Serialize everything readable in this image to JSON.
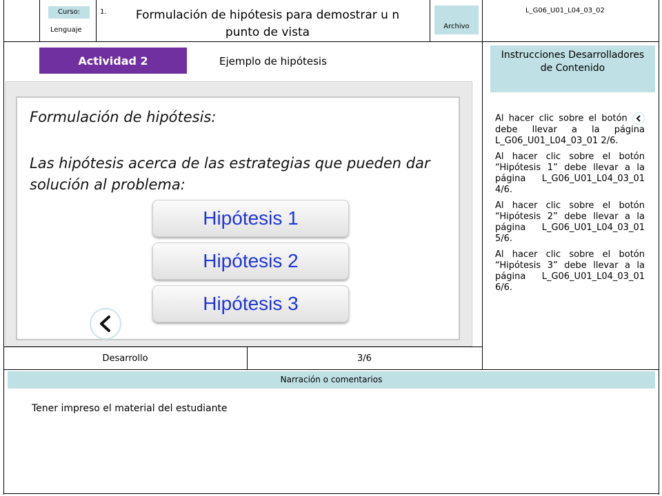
{
  "header": {
    "course_label": "Curso:",
    "course_value": "Lenguaje",
    "grade": "1.",
    "title": "Formulación de hipótesis para demostrar u n punto de vista",
    "file_label": "Archivo",
    "code": "L_G06_U01_L04_03_02"
  },
  "activity": {
    "badge": "Actividad 2",
    "subtitle": "Ejemplo de hipótesis"
  },
  "slide": {
    "heading": "Formulación de hipótesis:",
    "body": "Las hipótesis acerca de las estrategias que pueden dar solución al problema:",
    "buttons": [
      "Hipótesis 1",
      "Hipótesis 2",
      "Hipótesis 3"
    ],
    "back_icon": "chevron-left-icon"
  },
  "instructions": {
    "title": "Instrucciones Desarrolladores de Contenido",
    "p1_before": "Al hacer clic sobre el botón",
    "p1_after": "debe llevar a la página L_G06_U01_L04_03_01 2/6.",
    "p2": "Al hacer clic sobre el botón “Hipótesis 1” debe llevar a la página L_G06_U01_L04_03_01 4/6.",
    "p3": "Al hacer clic sobre el botón “Hipótesis 2” debe llevar a la página L_G06_U01_L04_03_01 5/6.",
    "p4": "Al hacer clic sobre el botón “Hipótesis 3” debe llevar a la página L_G06_U01_L04_03_01 6/6."
  },
  "footer_row": {
    "stage": "Desarrollo",
    "page": "3/6"
  },
  "narration": {
    "label": "Narración o comentarios",
    "text": "Tener impreso el material del estudiante"
  },
  "colors": {
    "badge": "#7030a0",
    "tag_bg": "#bfe0e4",
    "button_text": "#1f35d8"
  }
}
